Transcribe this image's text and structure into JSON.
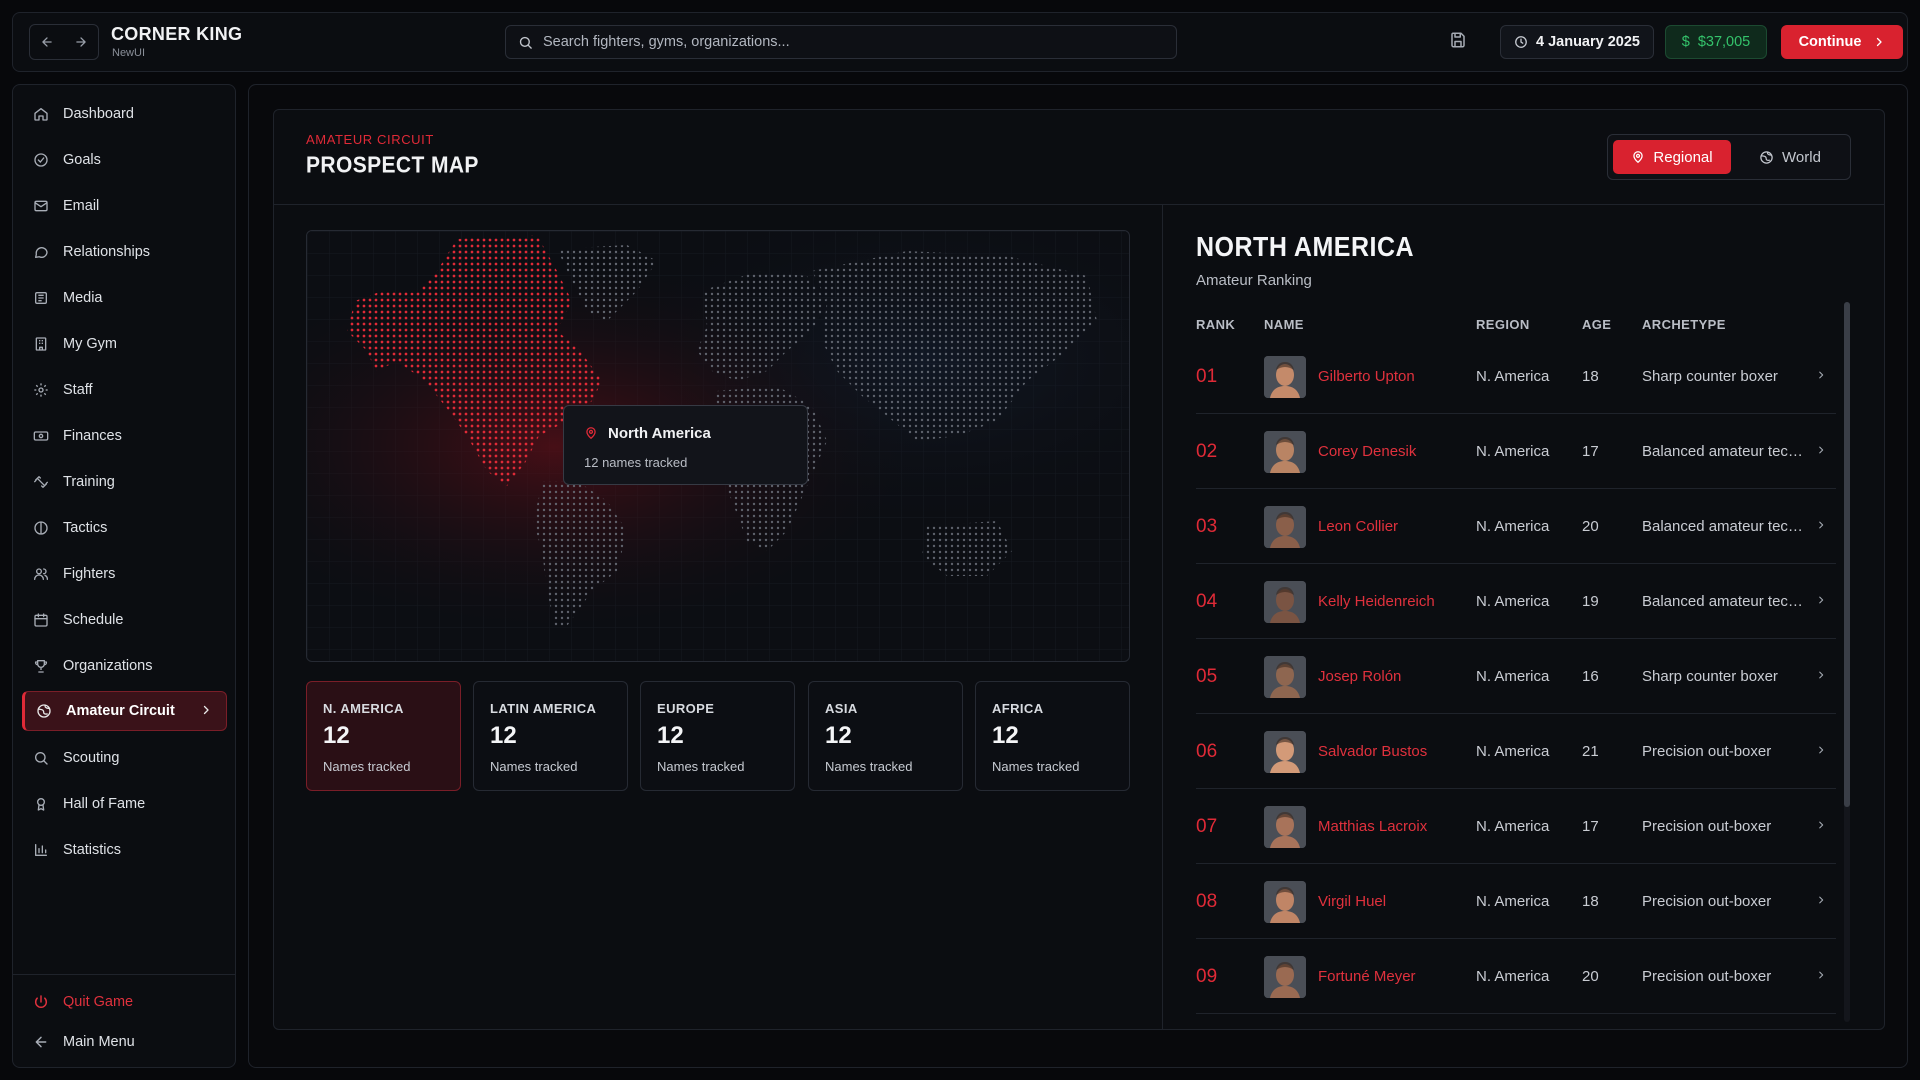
{
  "app": {
    "title": "CORNER KING",
    "subtitle": "NewUI"
  },
  "topbar": {
    "search_placeholder": "Search fighters, gyms, organizations...",
    "date": "4 January 2025",
    "money": "$37,005",
    "continue_label": "Continue"
  },
  "sidebar": {
    "items": [
      {
        "label": "Dashboard",
        "icon": "home-icon"
      },
      {
        "label": "Goals",
        "icon": "target-icon"
      },
      {
        "label": "Email",
        "icon": "mail-icon"
      },
      {
        "label": "Relationships",
        "icon": "chat-icon"
      },
      {
        "label": "Media",
        "icon": "newspaper-icon"
      },
      {
        "label": "My Gym",
        "icon": "building-icon"
      },
      {
        "label": "Staff",
        "icon": "gear-icon"
      },
      {
        "label": "Finances",
        "icon": "banknote-icon"
      },
      {
        "label": "Training",
        "icon": "dumbbell-icon"
      },
      {
        "label": "Tactics",
        "icon": "crosshair-icon"
      },
      {
        "label": "Fighters",
        "icon": "users-icon"
      },
      {
        "label": "Schedule",
        "icon": "calendar-icon"
      },
      {
        "label": "Organizations",
        "icon": "trophy-icon"
      },
      {
        "label": "Amateur Circuit",
        "icon": "globe-icon",
        "active": true
      },
      {
        "label": "Scouting",
        "icon": "search-icon"
      },
      {
        "label": "Hall of Fame",
        "icon": "award-icon"
      },
      {
        "label": "Statistics",
        "icon": "bar-chart-icon"
      }
    ],
    "quit_label": "Quit Game",
    "main_menu_label": "Main Menu"
  },
  "card": {
    "eyebrow": "AMATEUR CIRCUIT",
    "title": "PROSPECT MAP",
    "toggle": {
      "regional": "Regional",
      "world": "World",
      "selected": "Regional"
    }
  },
  "map": {
    "tooltip": {
      "title": "North America",
      "subtitle": "12 names tracked"
    }
  },
  "regions": [
    {
      "label": "N. AMERICA",
      "count": "12",
      "sub": "Names tracked",
      "active": true
    },
    {
      "label": "LATIN AMERICA",
      "count": "12",
      "sub": "Names tracked"
    },
    {
      "label": "EUROPE",
      "count": "12",
      "sub": "Names tracked"
    },
    {
      "label": "ASIA",
      "count": "12",
      "sub": "Names tracked"
    },
    {
      "label": "AFRICA",
      "count": "12",
      "sub": "Names tracked"
    }
  ],
  "ranking": {
    "title": "NORTH AMERICA",
    "subtitle": "Amateur Ranking",
    "columns": {
      "rank": "RANK",
      "name": "NAME",
      "region": "REGION",
      "age": "AGE",
      "archetype": "ARCHETYPE"
    },
    "rows": [
      {
        "rank": "01",
        "name": "Gilberto Upton",
        "region": "N. America",
        "age": "18",
        "archetype": "Sharp counter boxer"
      },
      {
        "rank": "02",
        "name": "Corey Denesik",
        "region": "N. America",
        "age": "17",
        "archetype": "Balanced amateur technician"
      },
      {
        "rank": "03",
        "name": "Leon Collier",
        "region": "N. America",
        "age": "20",
        "archetype": "Balanced amateur technician"
      },
      {
        "rank": "04",
        "name": "Kelly Heidenreich",
        "region": "N. America",
        "age": "19",
        "archetype": "Balanced amateur technician"
      },
      {
        "rank": "05",
        "name": "Josep Rolón",
        "region": "N. America",
        "age": "16",
        "archetype": "Sharp counter boxer"
      },
      {
        "rank": "06",
        "name": "Salvador Bustos",
        "region": "N. America",
        "age": "21",
        "archetype": "Precision out-boxer"
      },
      {
        "rank": "07",
        "name": "Matthias Lacroix",
        "region": "N. America",
        "age": "17",
        "archetype": "Precision out-boxer"
      },
      {
        "rank": "08",
        "name": "Virgil Huel",
        "region": "N. America",
        "age": "18",
        "archetype": "Precision out-boxer"
      },
      {
        "rank": "09",
        "name": "Fortuné Meyer",
        "region": "N. America",
        "age": "20",
        "archetype": "Precision out-boxer"
      }
    ]
  },
  "colors": {
    "accent": "#d9222f",
    "money": "#34c36b",
    "background": "#07080b"
  }
}
